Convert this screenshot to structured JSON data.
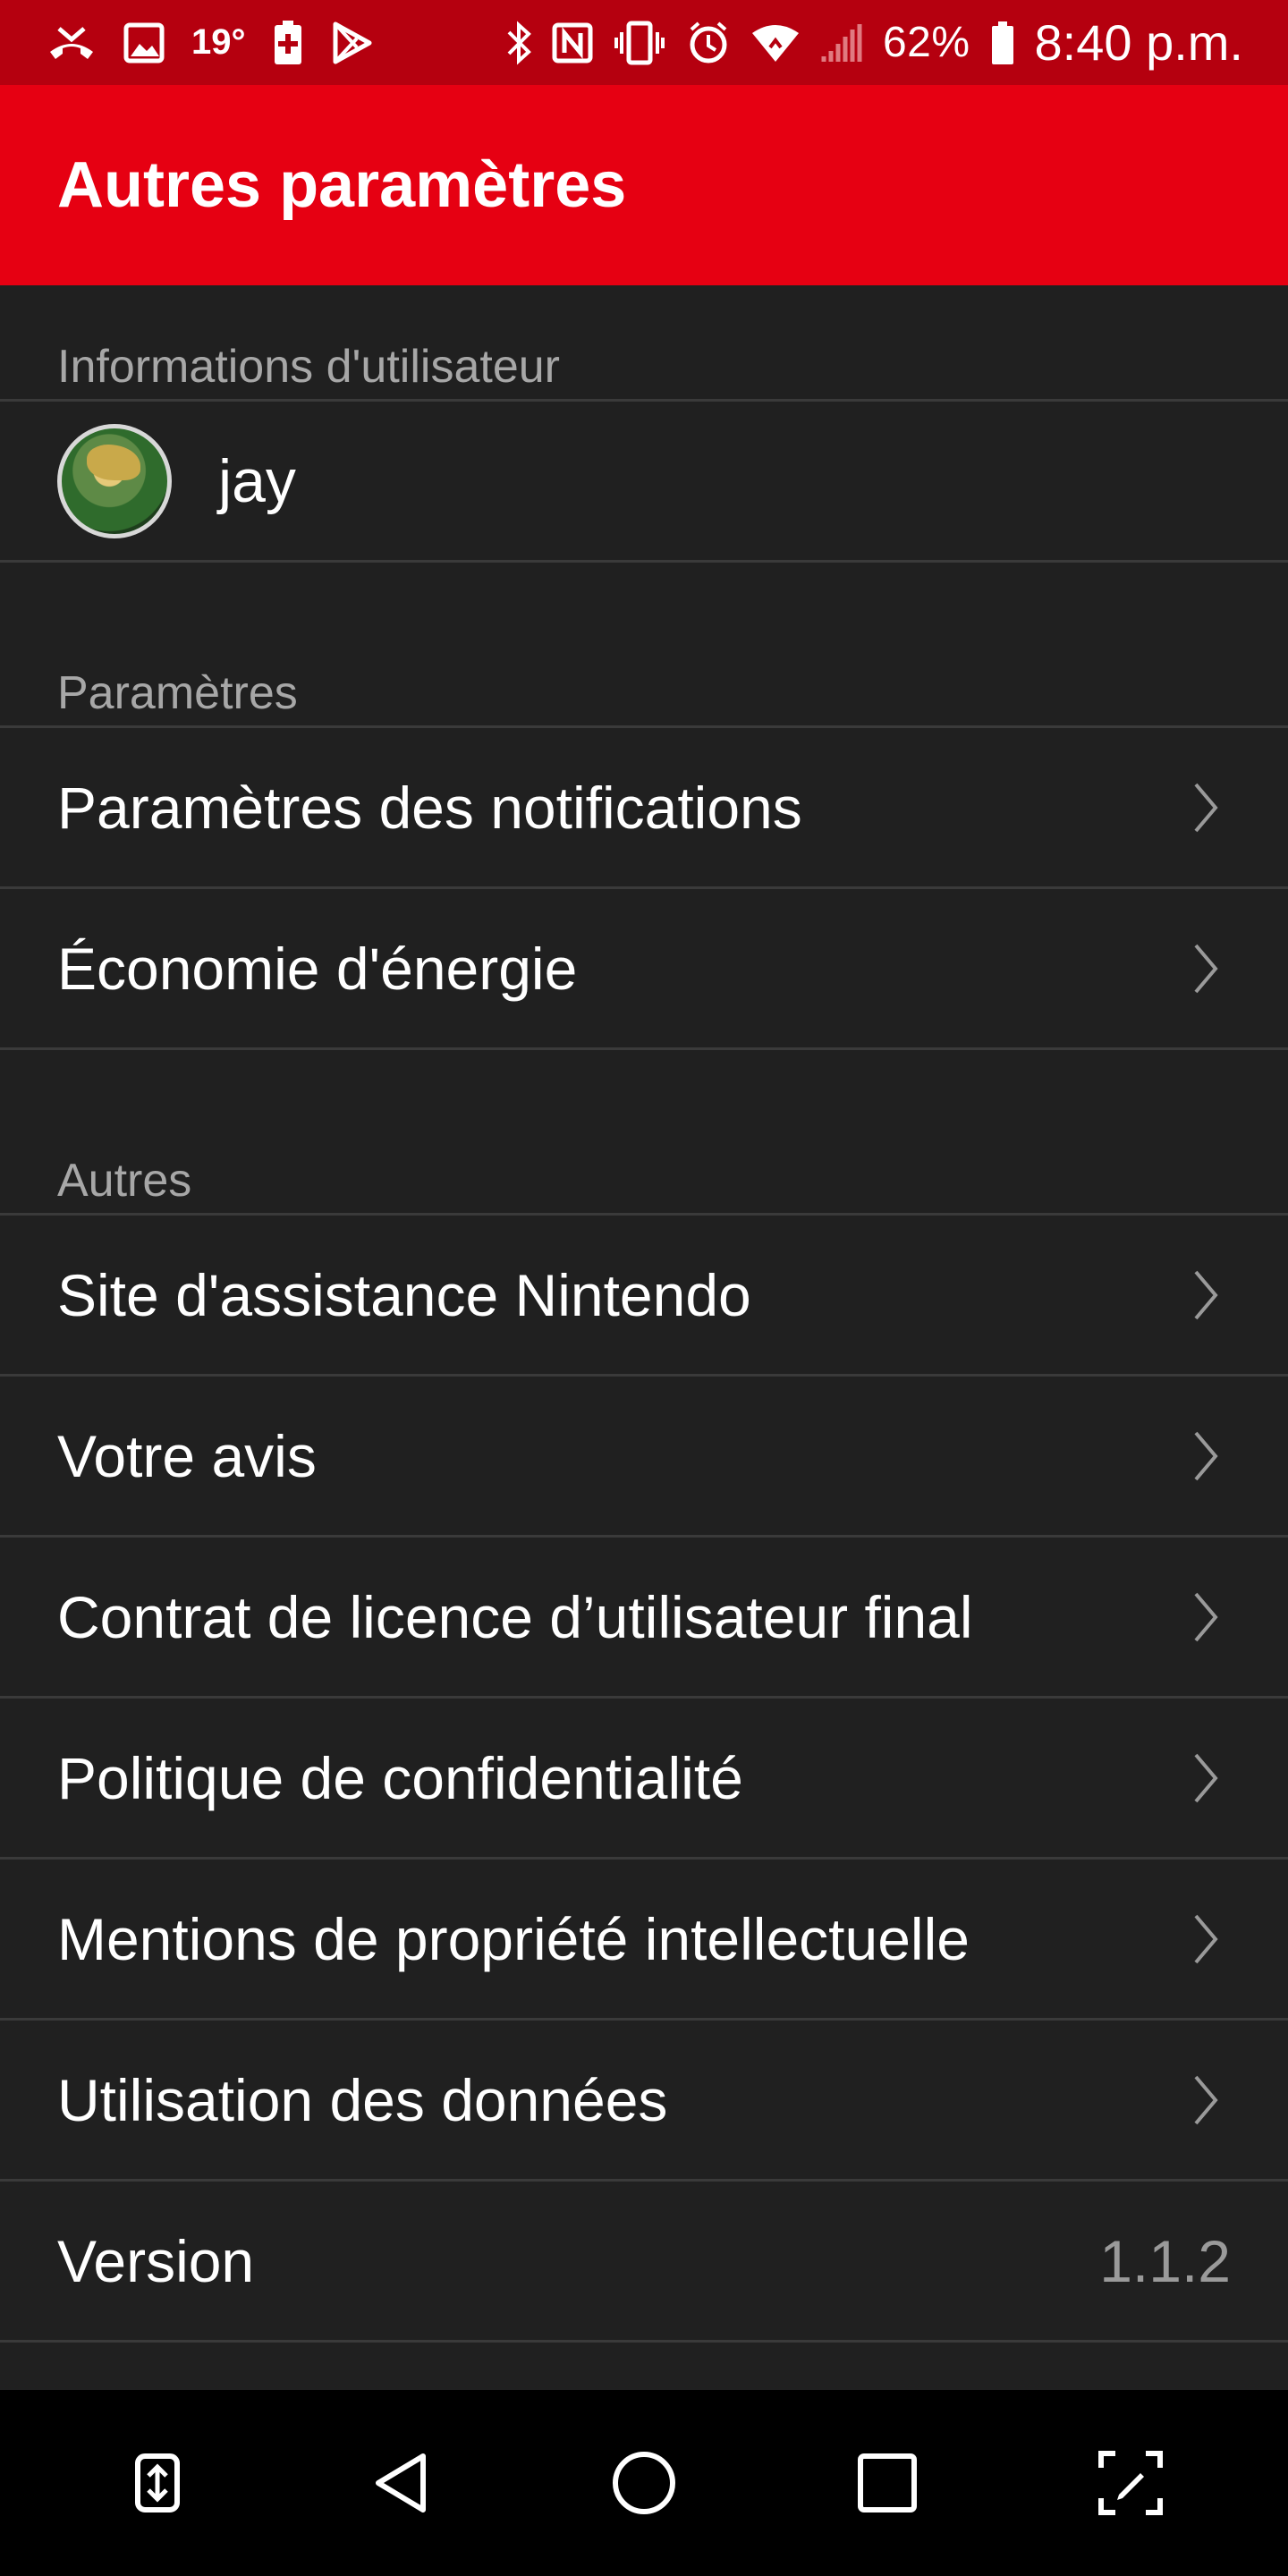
{
  "status_bar": {
    "temperature": "19°",
    "battery_percent": "62%",
    "time": "8:40 p.m.",
    "color": "#b5000f",
    "left_icons": [
      "missed-call-icon",
      "gallery-icon",
      "battery-saver-icon",
      "play-store-icon"
    ],
    "right_icons": [
      "bluetooth-icon",
      "nfc-icon",
      "vibrate-icon",
      "alarm-icon",
      "wifi-icon",
      "signal-icon",
      "battery-icon"
    ]
  },
  "app_bar": {
    "title": "Autres paramètres",
    "color": "#e60012"
  },
  "sections": {
    "user_info": {
      "header": "Informations d'utilisateur",
      "username": "jay"
    },
    "settings": {
      "header": "Paramètres",
      "items": [
        {
          "label": "Paramètres des notifications"
        },
        {
          "label": "Économie d'énergie"
        }
      ]
    },
    "others": {
      "header": "Autres",
      "items": [
        {
          "label": "Site d'assistance Nintendo"
        },
        {
          "label": "Votre avis"
        },
        {
          "label": "Contrat de licence d’utilisateur final"
        },
        {
          "label": "Politique de confidentialité"
        },
        {
          "label": "Mentions de propriété intellectuelle"
        },
        {
          "label": "Utilisation des données"
        }
      ],
      "version_label": "Version",
      "version_value": "1.1.2"
    }
  },
  "nav_bar": {
    "buttons": [
      "swap-app-icon",
      "back-icon",
      "home-icon",
      "recents-icon",
      "capture-icon"
    ]
  }
}
